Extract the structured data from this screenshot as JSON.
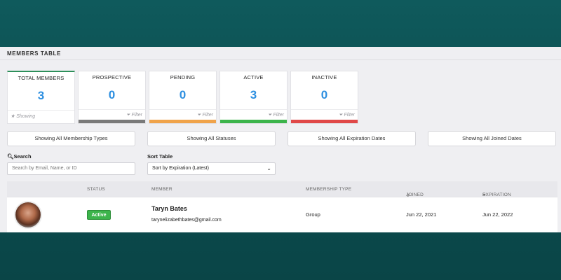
{
  "page": {
    "title": "MEMBERS TABLE"
  },
  "stats": [
    {
      "label": "TOTAL MEMBERS",
      "value": "3",
      "footer": "Showing",
      "bar_color": ""
    },
    {
      "label": "PROSPECTIVE",
      "value": "0",
      "footer": "Filter",
      "bar_color": "#7a7a7a"
    },
    {
      "label": "PENDING",
      "value": "0",
      "footer": "Filter",
      "bar_color": "#f0a34a"
    },
    {
      "label": "ACTIVE",
      "value": "3",
      "footer": "Filter",
      "bar_color": "#3cb44b"
    },
    {
      "label": "INACTIVE",
      "value": "0",
      "footer": "Filter",
      "bar_color": "#e04848"
    }
  ],
  "filters": {
    "membership_types": "Showing All Membership Types",
    "statuses": "Showing All Statuses",
    "expiration_dates": "Showing All Expiration Dates",
    "joined_dates": "Showing All Joined Dates"
  },
  "search": {
    "label": "Search",
    "placeholder": "Search by Email, Name, or ID"
  },
  "sort": {
    "label": "Sort Table",
    "value": "Sort by Expiration (Latest)"
  },
  "table": {
    "headers": {
      "status": "STATUS",
      "member": "MEMBER",
      "type": "MEMBERSHIP TYPE",
      "joined": "JOINED",
      "expiration": "EXPIRATION"
    },
    "rows": [
      {
        "status": "Active",
        "name": "Taryn Bates",
        "email": "tarynelizabethbates@gmail.com",
        "type": "Group",
        "joined": "Jun 22, 2021",
        "expiration": "Jun 22, 2022"
      }
    ]
  },
  "colors": {
    "accent_blue": "#2d8fe0",
    "active_green": "#3cb44b",
    "background_teal": "#0f5a5c"
  },
  "icons": {
    "search": "search-icon",
    "star": "star-icon",
    "filter": "filter-icon",
    "sort_up": "sort-up-icon",
    "sort_down": "sort-down-icon",
    "chevron": "chevron-down-icon"
  }
}
